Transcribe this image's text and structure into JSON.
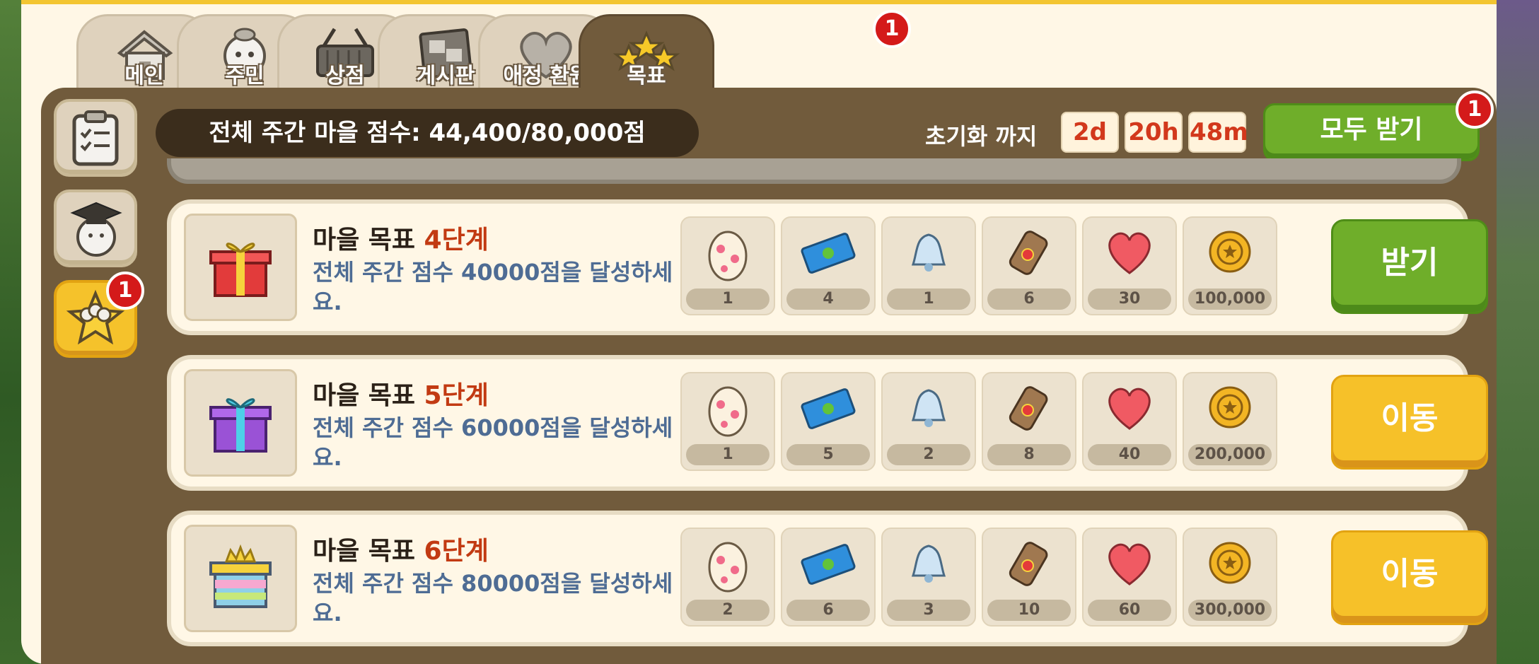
{
  "tabs": [
    {
      "label": "메인",
      "icon": "house-icon"
    },
    {
      "label": "주민",
      "icon": "villager-icon"
    },
    {
      "label": "상점",
      "icon": "basket-icon"
    },
    {
      "label": "게시판",
      "icon": "board-icon"
    },
    {
      "label": "애정 환원",
      "icon": "heart-icon"
    },
    {
      "label": "목표",
      "icon": "stars-icon",
      "badge": "1",
      "active": true
    }
  ],
  "sidebar": {
    "items": [
      {
        "icon": "clipboard-icon"
      },
      {
        "icon": "graduate-icon"
      },
      {
        "icon": "star-group-icon",
        "badge": "1",
        "active": true
      }
    ]
  },
  "header": {
    "score_text": "전체 주간 마을 점수: 44,400/80,000점",
    "reset_label": "초기화 까지",
    "time": {
      "days": "2d",
      "hours": "20h",
      "minutes": "48m"
    },
    "claim_all_label": "모두 받기",
    "claim_all_badge": "1"
  },
  "goals": [
    {
      "title": "마을 목표 ",
      "stage": "4단계",
      "description": "전체 주간 점수 40000점을 달성하세요.",
      "gift": "red-gift-icon",
      "rewards": [
        "1",
        "4",
        "1",
        "6",
        "30",
        "100,000"
      ],
      "button": "받기",
      "button_color": "#6fae2a"
    },
    {
      "title": "마을 목표 ",
      "stage": "5단계",
      "description": "전체 주간 점수 60000점을 달성하세요.",
      "gift": "purple-gift-icon",
      "rewards": [
        "1",
        "5",
        "2",
        "8",
        "40",
        "200,000"
      ],
      "button": "이동",
      "button_color": "#f6c129"
    },
    {
      "title": "마을 목표 ",
      "stage": "6단계",
      "description": "전체 주간 점수 80000점을 달성하세요.",
      "gift": "rainbow-gift-icon",
      "rewards": [
        "2",
        "6",
        "3",
        "10",
        "60",
        "300,000"
      ],
      "button": "이동",
      "button_color": "#f6c129"
    }
  ],
  "reward_icons": [
    "egg-icon",
    "ticket-icon",
    "bell-icon",
    "scroll-icon",
    "heart-icon",
    "coin-icon"
  ]
}
